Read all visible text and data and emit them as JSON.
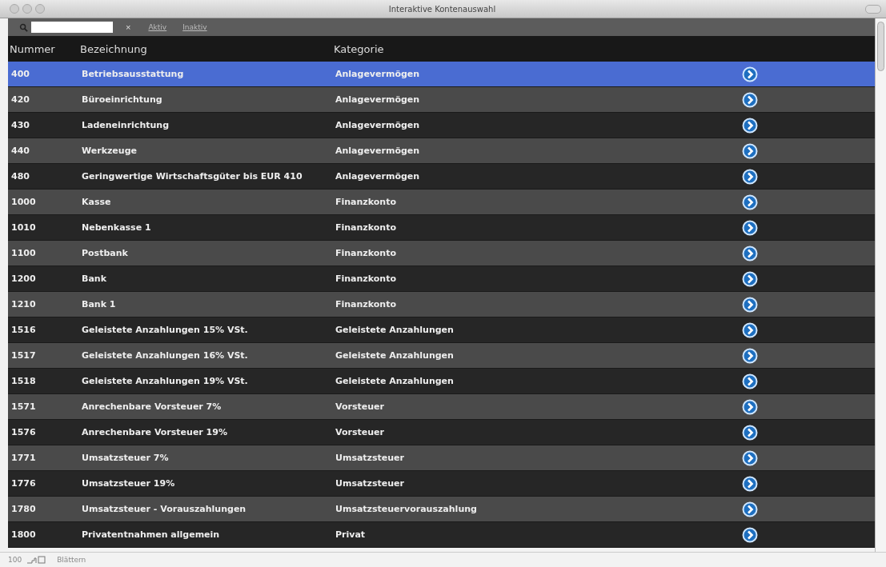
{
  "window": {
    "title": "Interaktive Kontenauswahl"
  },
  "toolbar": {
    "clear": "×",
    "links": [
      "Aktiv",
      "Inaktiv"
    ]
  },
  "table": {
    "columns": [
      "Nummer",
      "Bezeichnung",
      "Kategorie"
    ],
    "rows": [
      {
        "number": "400",
        "name": "Betriebsausstattung",
        "category": "Anlagevermögen",
        "selected": true
      },
      {
        "number": "420",
        "name": "Büroeinrichtung",
        "category": "Anlagevermögen",
        "selected": false
      },
      {
        "number": "430",
        "name": "Ladeneinrichtung",
        "category": "Anlagevermögen",
        "selected": false
      },
      {
        "number": "440",
        "name": "Werkzeuge",
        "category": "Anlagevermögen",
        "selected": false
      },
      {
        "number": "480",
        "name": "Geringwertige Wirtschaftsgüter bis EUR 410",
        "category": "Anlagevermögen",
        "selected": false
      },
      {
        "number": "1000",
        "name": "Kasse",
        "category": "Finanzkonto",
        "selected": false
      },
      {
        "number": "1010",
        "name": "Nebenkasse 1",
        "category": "Finanzkonto",
        "selected": false
      },
      {
        "number": "1100",
        "name": "Postbank",
        "category": "Finanzkonto",
        "selected": false
      },
      {
        "number": "1200",
        "name": "Bank",
        "category": "Finanzkonto",
        "selected": false
      },
      {
        "number": "1210",
        "name": "Bank 1",
        "category": "Finanzkonto",
        "selected": false
      },
      {
        "number": "1516",
        "name": "Geleistete Anzahlungen 15% VSt.",
        "category": "Geleistete Anzahlungen",
        "selected": false
      },
      {
        "number": "1517",
        "name": "Geleistete Anzahlungen 16% VSt.",
        "category": "Geleistete Anzahlungen",
        "selected": false
      },
      {
        "number": "1518",
        "name": "Geleistete Anzahlungen 19% VSt.",
        "category": "Geleistete Anzahlungen",
        "selected": false
      },
      {
        "number": "1571",
        "name": "Anrechenbare Vorsteuer 7%",
        "category": "Vorsteuer",
        "selected": false
      },
      {
        "number": "1576",
        "name": "Anrechenbare Vorsteuer 19%",
        "category": "Vorsteuer",
        "selected": false
      },
      {
        "number": "1771",
        "name": "Umsatzsteuer 7%",
        "category": "Umsatzsteuer",
        "selected": false
      },
      {
        "number": "1776",
        "name": "Umsatzsteuer 19%",
        "category": "Umsatzsteuer",
        "selected": false
      },
      {
        "number": "1780",
        "name": "Umsatzsteuer - Vorauszahlungen",
        "category": "Umsatzsteuervorauszahlung",
        "selected": false
      },
      {
        "number": "1800",
        "name": "Privatentnahmen allgemein",
        "category": "Privat",
        "selected": false
      }
    ]
  },
  "status_bar": {
    "zoom": "100",
    "mode": "Blättern"
  }
}
